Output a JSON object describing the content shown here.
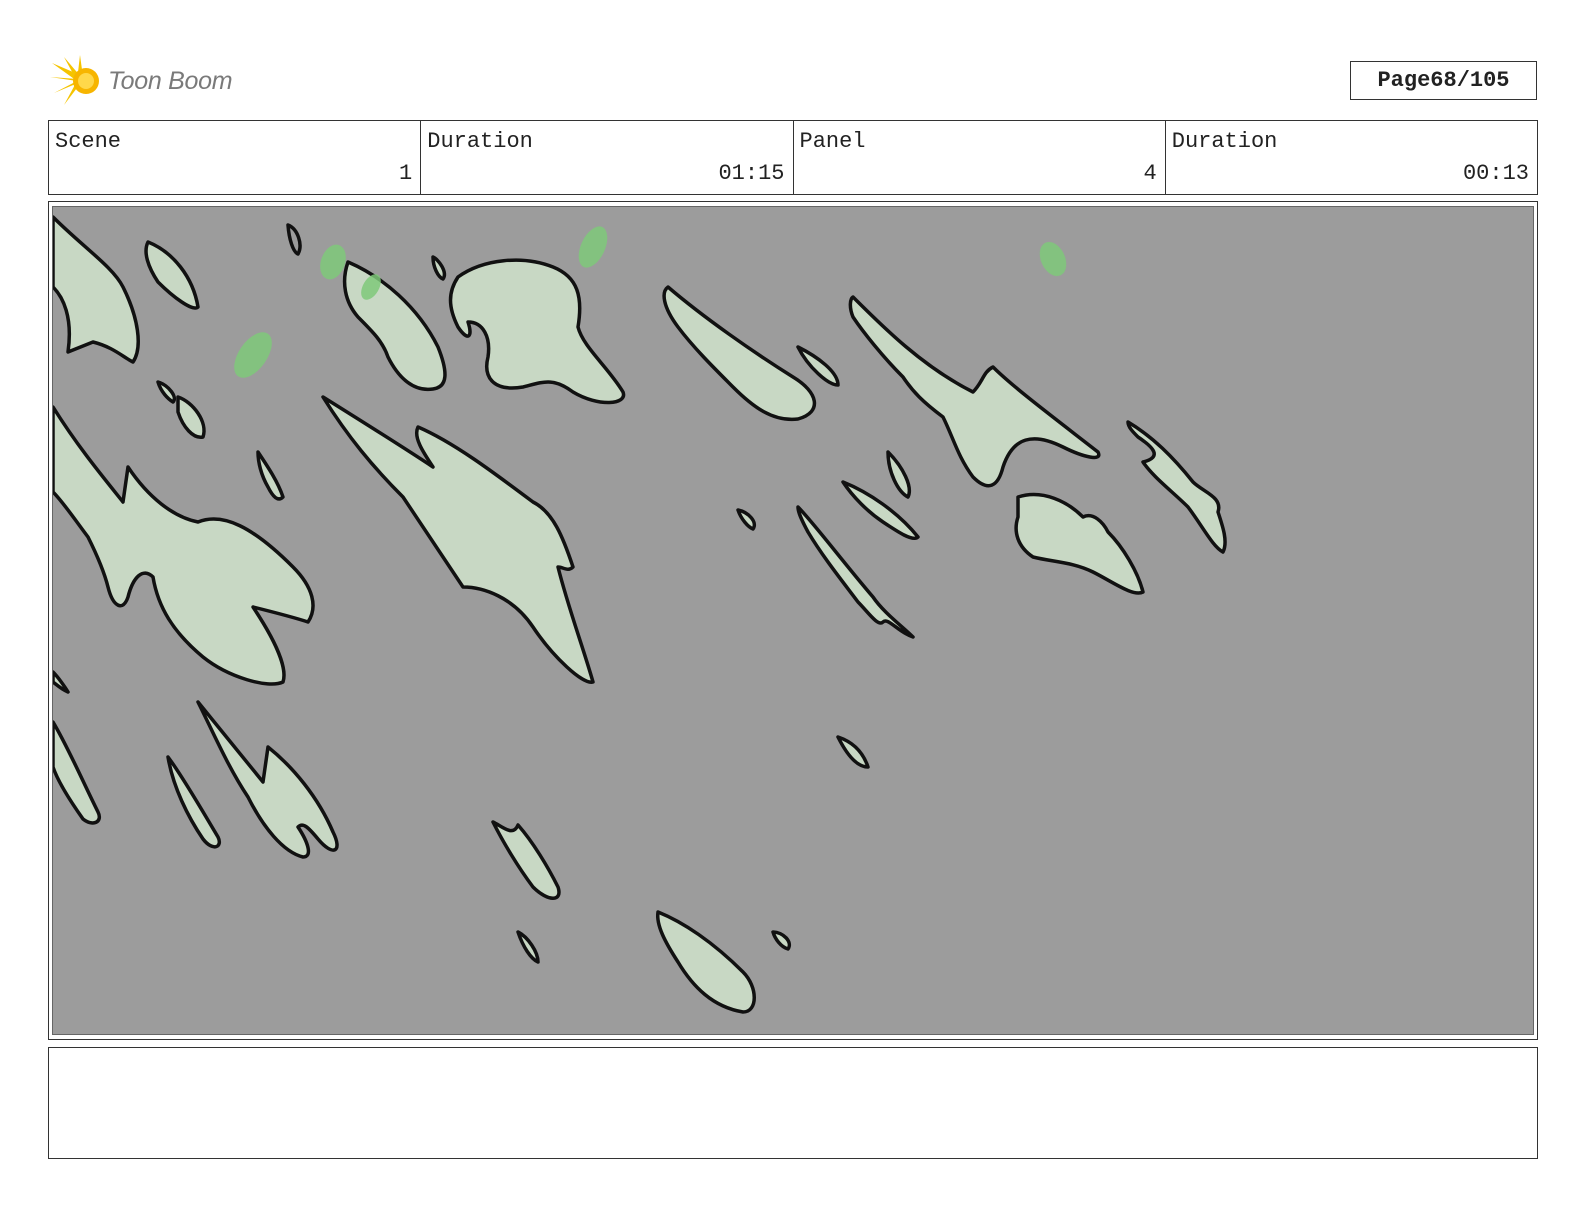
{
  "logo": {
    "text": "Toon Boom",
    "icon": "sunburst-logo-icon"
  },
  "page": {
    "label": "Page",
    "value": "68/105"
  },
  "info": {
    "scene": {
      "label": "Scene",
      "value": "1"
    },
    "scene_duration": {
      "label": "Duration",
      "value": "01:15"
    },
    "panel": {
      "label": "Panel",
      "value": "4"
    },
    "panel_duration": {
      "label": "Duration",
      "value": "00:13"
    }
  },
  "panel_image": {
    "description_icon": "storyboard-drawing",
    "colors": {
      "background": "#9c9c9c",
      "shape_fill": "#c8d8c4",
      "leaf_green": "#7fc97a",
      "stroke": "#111111"
    }
  },
  "caption": {
    "text": ""
  }
}
